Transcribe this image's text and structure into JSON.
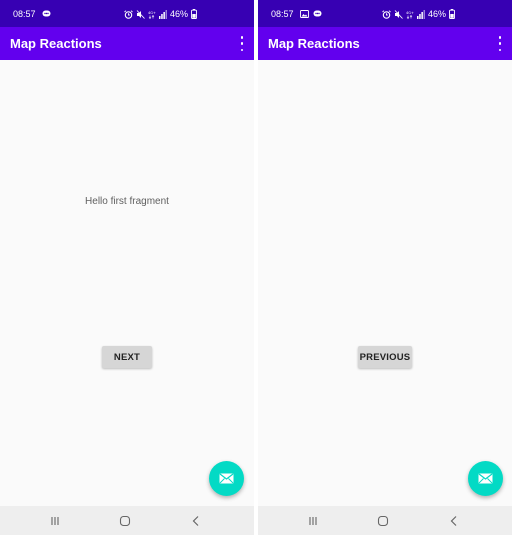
{
  "left_screen": {
    "status_bar": {
      "time": "08:57",
      "battery": "46%"
    },
    "app_bar": {
      "title": "Map Reactions"
    },
    "content": {
      "message": "Hello first fragment",
      "button_label": "NEXT"
    },
    "fab_icon": "mail-icon",
    "nav_icons": [
      "recents-icon",
      "home-icon",
      "back-icon"
    ]
  },
  "right_screen": {
    "status_bar": {
      "time": "08:57",
      "battery": "46%"
    },
    "app_bar": {
      "title": "Map Reactions"
    },
    "content": {
      "button_label": "PREVIOUS"
    },
    "fab_icon": "mail-icon",
    "nav_icons": [
      "recents-icon",
      "home-icon",
      "back-icon"
    ]
  },
  "colors": {
    "status_bar": "#3700b3",
    "app_bar": "#6200ee",
    "fab": "#03dac5",
    "background": "#fafafa",
    "button": "#d6d6d6",
    "nav_bar": "#eeeeee"
  }
}
